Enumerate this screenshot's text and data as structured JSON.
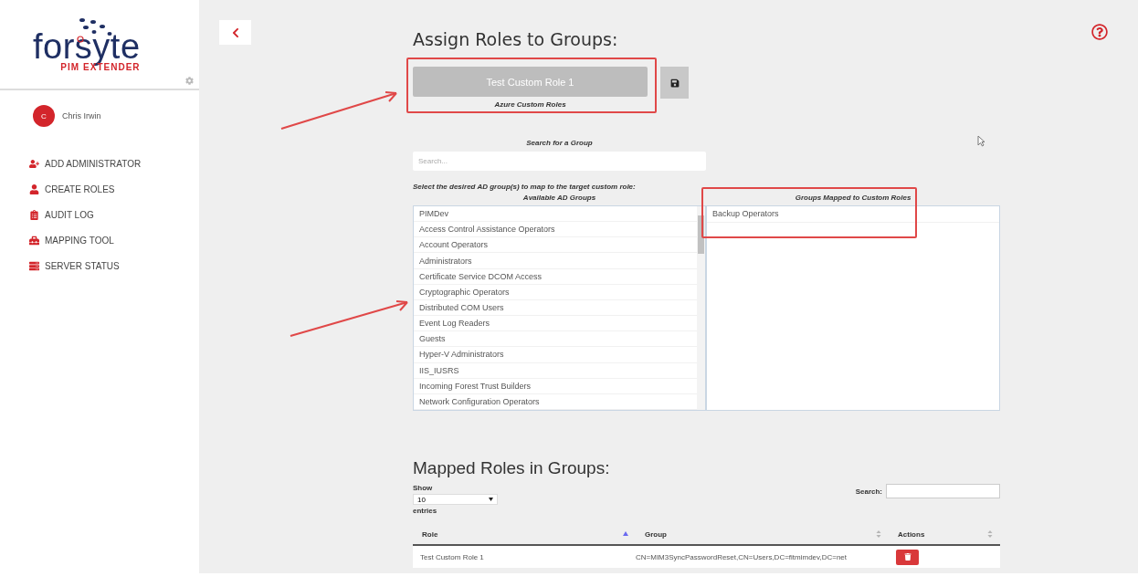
{
  "sidebar": {
    "logo": {
      "name": "forsyte",
      "tagline_1": "PIM",
      "tagline_2": "EXTENDER"
    },
    "user": {
      "initial": "C",
      "name": "Chris Irwin"
    },
    "items": [
      {
        "label": "ADD ADMINISTRATOR",
        "kind": "user-plus"
      },
      {
        "label": "CREATE ROLES",
        "kind": "user"
      },
      {
        "label": "AUDIT LOG",
        "kind": "log"
      },
      {
        "label": "MAPPING TOOL",
        "kind": "toolbox"
      },
      {
        "label": "SERVER STATUS",
        "kind": "server"
      }
    ]
  },
  "assign": {
    "title": "Assign Roles to Groups:",
    "role_button": "Test Custom Role 1",
    "role_caption": "Azure Custom Roles",
    "search_label": "Search for a Group",
    "search_placeholder": "Search...",
    "instruction": "Select the desired AD group(s) to map to the target custom role:",
    "available": {
      "heading": "Available AD Groups",
      "items": [
        "PIMDev",
        "Access Control Assistance Operators",
        "Account Operators",
        "Administrators",
        "Certificate Service DCOM Access",
        "Cryptographic Operators",
        "Distributed COM Users",
        "Event Log Readers",
        "Guests",
        "Hyper-V Administrators",
        "IIS_IUSRS",
        "Incoming Forest Trust Builders",
        "Network Configuration Operators"
      ]
    },
    "mapped": {
      "heading": "Groups Mapped to Custom Roles",
      "items": [
        "Backup Operators"
      ]
    }
  },
  "mapped_table": {
    "title": "Mapped Roles in Groups:",
    "show_label": "Show",
    "page_size": "10",
    "entries_label": "entries",
    "search_label": "Search:",
    "columns": [
      {
        "label": "Role",
        "sorted": true
      },
      {
        "label": "Group",
        "sorted": false
      },
      {
        "label": "Actions",
        "sorted": false
      }
    ],
    "rows": [
      {
        "role": "Test Custom Role 1",
        "group": "CN=MIM3SyncPasswordReset,CN=Users,DC=fitmimdev,DC=net"
      }
    ]
  }
}
